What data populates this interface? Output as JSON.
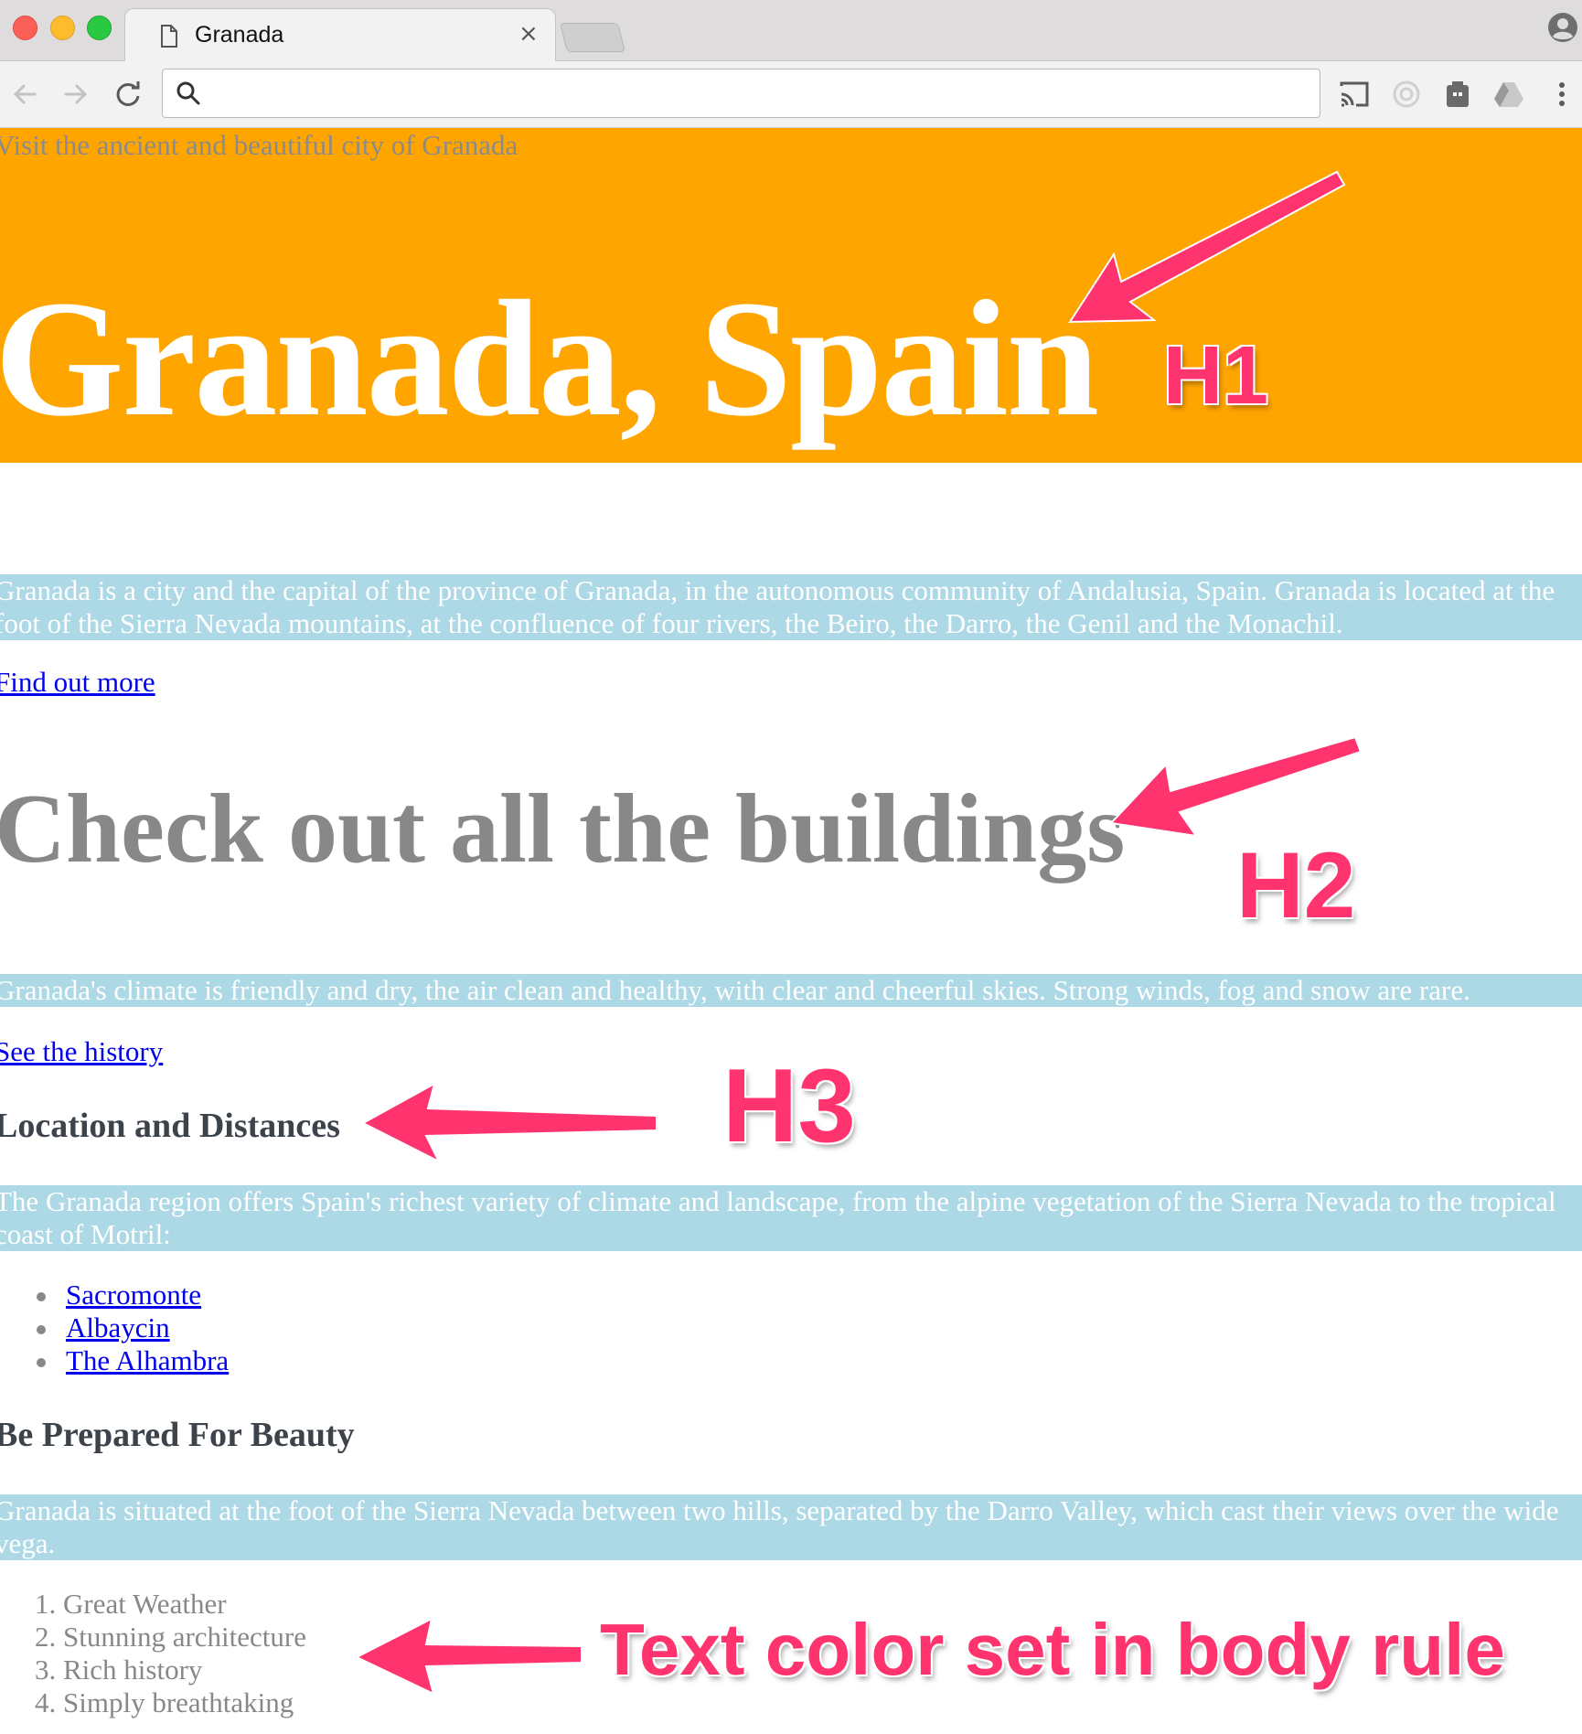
{
  "browser": {
    "tab_title": "Granada",
    "tab_close": "×",
    "address_value": "",
    "icons": [
      "file-icon",
      "back-icon",
      "forward-icon",
      "reload-icon",
      "search-icon",
      "cast-icon",
      "extension-icon",
      "extension-icon",
      "drive-icon",
      "menu-icon",
      "profile-icon"
    ]
  },
  "page": {
    "tagline": "Visit the ancient and beautiful city of Granada",
    "h1": "Granada, Spain",
    "intro": "Granada is a city and the capital of the province of Granada, in the autonomous community of Andalusia, Spain. Granada is located at the foot of the Sierra Nevada mountains, at the confluence of four rivers, the Beiro, the Darro, the Genil and the Monachil.",
    "link_more": "Find out more",
    "h2": "Check out all the buildings",
    "climate": "Granada's climate is friendly and dry, the air clean and healthy, with clear and cheerful skies. Strong winds, fog and snow are rare.",
    "link_history": "See the history",
    "h3_location": "Location and Distances",
    "region": "The Granada region offers Spain's richest variety of climate and landscape, from the alpine vegetation of the Sierra Nevada to the tropical coast of Motril:",
    "places": [
      "Sacromonte",
      "Albaycin",
      "The Alhambra"
    ],
    "h3_beauty": "Be Prepared For Beauty",
    "situated": "Granada is situated at the foot of the Sierra Nevada between two hills, separated by the Darro Valley, which cast their views over the wide vega.",
    "reasons": [
      "1. Great Weather",
      "2. Stunning architecture",
      "3. Rich history",
      "4. Simply breathtaking"
    ],
    "colors": {
      "header": "#ffa500",
      "band": "#add8e6",
      "body_text": "#888888",
      "link": "#0000ee",
      "heading3": "#3d434b"
    }
  },
  "annotations": {
    "h1": "H1",
    "h2": "H2",
    "h3": "H3",
    "body_rule": "Text color set in body rule",
    "color": "#ff336e"
  }
}
